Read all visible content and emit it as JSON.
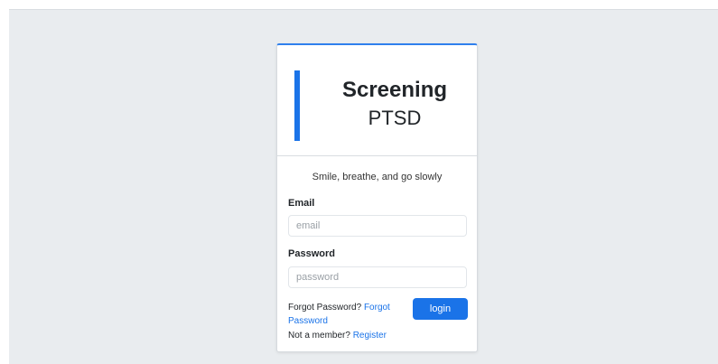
{
  "brand": {
    "title": "Screening",
    "subtitle": "PTSD"
  },
  "tagline": "Smile, breathe, and go slowly",
  "form": {
    "email": {
      "label": "Email",
      "placeholder": "email",
      "value": ""
    },
    "password": {
      "label": "Password",
      "placeholder": "password",
      "value": ""
    },
    "login_label": "login"
  },
  "links": {
    "forgot_prefix": "Forgot Password?",
    "forgot_link": "Forgot Password",
    "member_prefix": "Not a member?",
    "register_link": "Register"
  },
  "colors": {
    "accent": "#1a73e8",
    "background": "#e9ecef"
  }
}
